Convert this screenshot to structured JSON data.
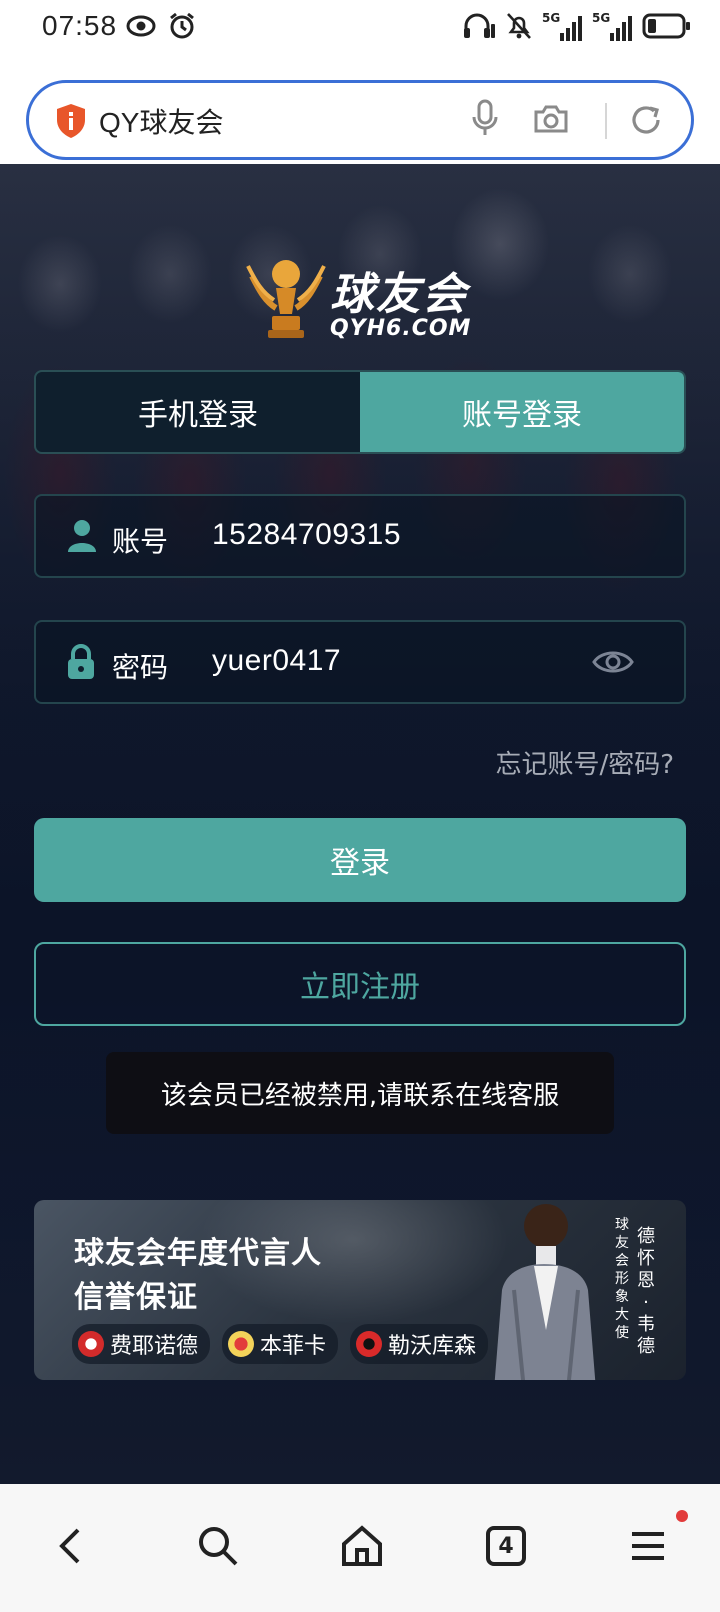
{
  "status_bar": {
    "time": "07:58",
    "left_icons": [
      "eye-icon",
      "alarm-icon"
    ],
    "right_icons": [
      "headphones-icon",
      "mute-icon",
      "signal-5g-icon",
      "signal-5g-icon",
      "battery-icon"
    ],
    "network_1": "5G",
    "network_2": "5G",
    "battery_level": 0.25
  },
  "url_bar": {
    "text": "QY球友会",
    "icons": [
      "shield-icon",
      "mic-icon",
      "camera-icon",
      "reload-icon"
    ]
  },
  "logo": {
    "name": "球友会",
    "domain": "QYH6.COM",
    "trophy_text": "球友会"
  },
  "login_tabs": [
    {
      "label": "手机登录",
      "active": false
    },
    {
      "label": "账号登录",
      "active": true
    }
  ],
  "fields": {
    "account": {
      "label": "账号",
      "value": "15284709315",
      "icon": "user-icon"
    },
    "password": {
      "label": "密码",
      "value": "yuer0417",
      "icon": "lock-icon",
      "toggle_icon": "eye-icon"
    }
  },
  "forgot_link": "忘记账号/密码?",
  "login_button": "登录",
  "register_button": "立即注册",
  "toast": "该会员已经被禁用,请联系在线客服",
  "banner": {
    "title_line1": "球友会年度代言人",
    "title_line2": "信誉保证",
    "teams": [
      "费耶诺德",
      "本菲卡",
      "勒沃库森"
    ],
    "vertical_caption": "球友会形象大使",
    "vertical_name": "德怀恩·韦德"
  },
  "bottom_nav": {
    "items": [
      "back-icon",
      "search-icon",
      "home-icon",
      "tabs-icon",
      "menu-icon"
    ],
    "tab_count": "4",
    "menu_notification": true
  },
  "colors": {
    "accent": "#4ea7a0",
    "url_border": "#3b6fd6",
    "notification": "#e23b3b"
  }
}
